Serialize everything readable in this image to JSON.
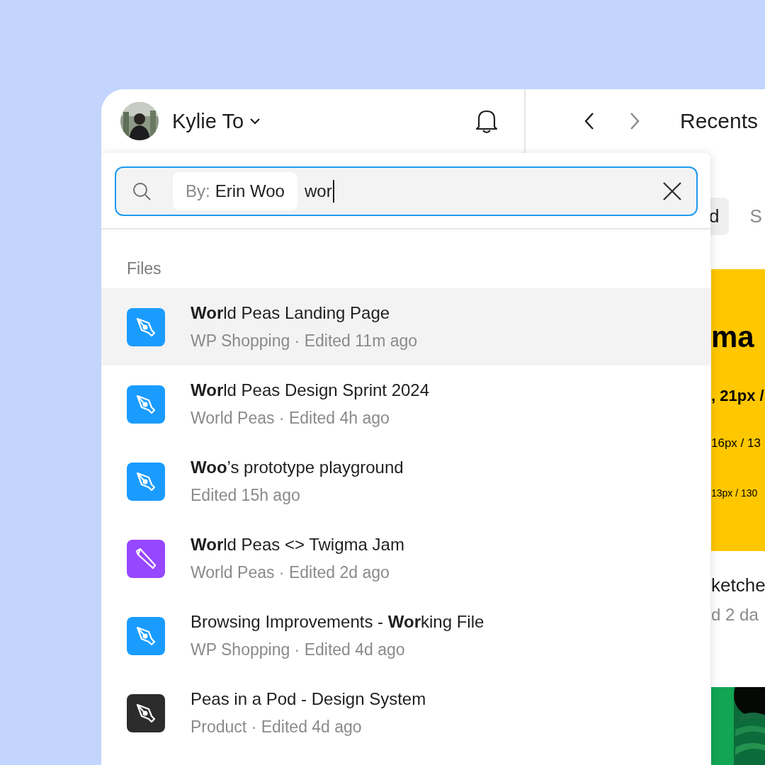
{
  "account": {
    "name": "Kylie To",
    "avatar": {
      "kind": "picture"
    }
  },
  "navigation": {
    "title": "Recents"
  },
  "search": {
    "filter_label": "By:",
    "filter_value": "Erin Woo",
    "value": "wor"
  },
  "results": {
    "section": "Files",
    "items": [
      {
        "title": "**Wor**ld Peas Landing Page",
        "subtitle": "WP Shopping · Edited 11m ago",
        "kind": "pen",
        "color": "#1a9cff",
        "selected": true
      },
      {
        "title": "**Wor**ld Peas Design Sprint 2024",
        "subtitle": "World Peas · Edited 4h ago",
        "kind": "pen",
        "color": "#1a9cff",
        "selected": false
      },
      {
        "title": "**Woo**’s prototype playground",
        "subtitle": "Edited 15h ago",
        "kind": "pen",
        "color": "#1a9cff",
        "selected": false
      },
      {
        "title": "**Wor**ld Peas <> Twigma Jam",
        "subtitle": "World Peas · Edited 2d ago",
        "kind": "pencil",
        "color": "#9747ff",
        "selected": false
      },
      {
        "title": "Browsing Improvements - **Wor**king File",
        "subtitle": "WP Shopping · Edited 4d ago",
        "kind": "pen",
        "color": "#1a9cff",
        "selected": false
      },
      {
        "title": "Peas in a Pod - Design System",
        "subtitle": "Product · Edited 4d ago",
        "kind": "pen",
        "color": "#2c2c2c",
        "selected": false
      }
    ]
  },
  "tabs": [
    {
      "label": "d",
      "selected": true
    },
    {
      "label": "S",
      "selected": false
    }
  ],
  "cards": [
    {
      "kind": "type",
      "lines": [
        "ma",
        ", 21px /",
        "16px / 13",
        "13px / 130"
      ],
      "title": "ketche",
      "subtitle": "d 2 da"
    },
    {
      "kind": "picture"
    }
  ]
}
